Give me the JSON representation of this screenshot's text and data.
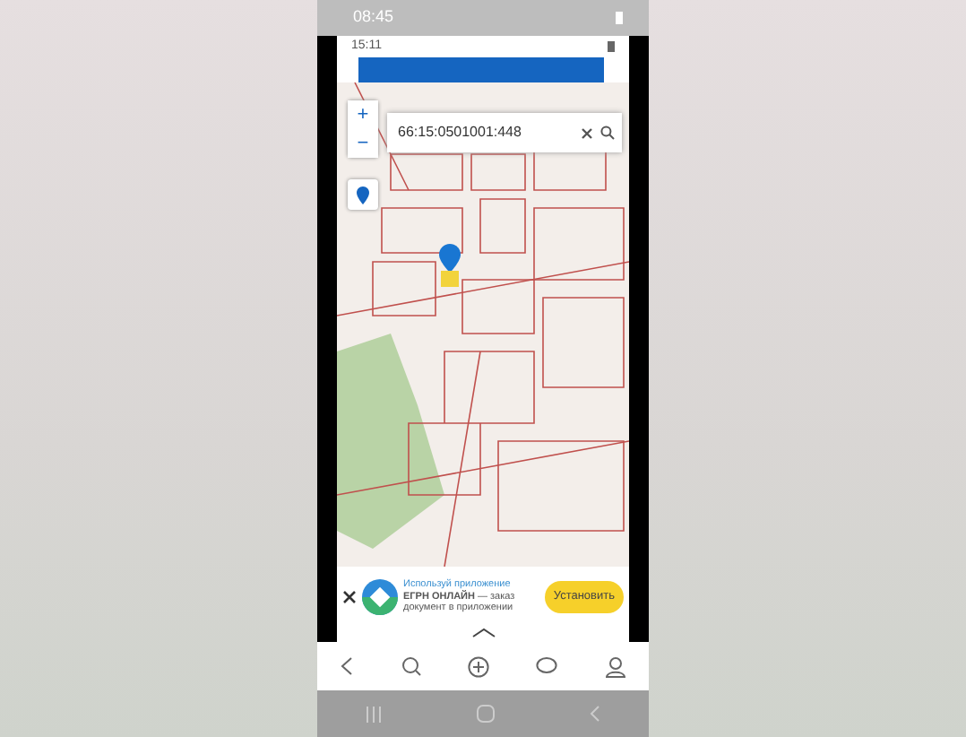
{
  "phone_status_bar": {
    "time": "08:45"
  },
  "app_status_bar": {
    "time": "15:11"
  },
  "search": {
    "value": "66:15:0501001:448"
  },
  "zoom_controls": [
    "+",
    "−"
  ],
  "ad": {
    "title": "Используй приложение",
    "app_name": "ЕГРН ОНЛАЙН",
    "description": "— заказ документ в приложении",
    "button": "Установить"
  }
}
